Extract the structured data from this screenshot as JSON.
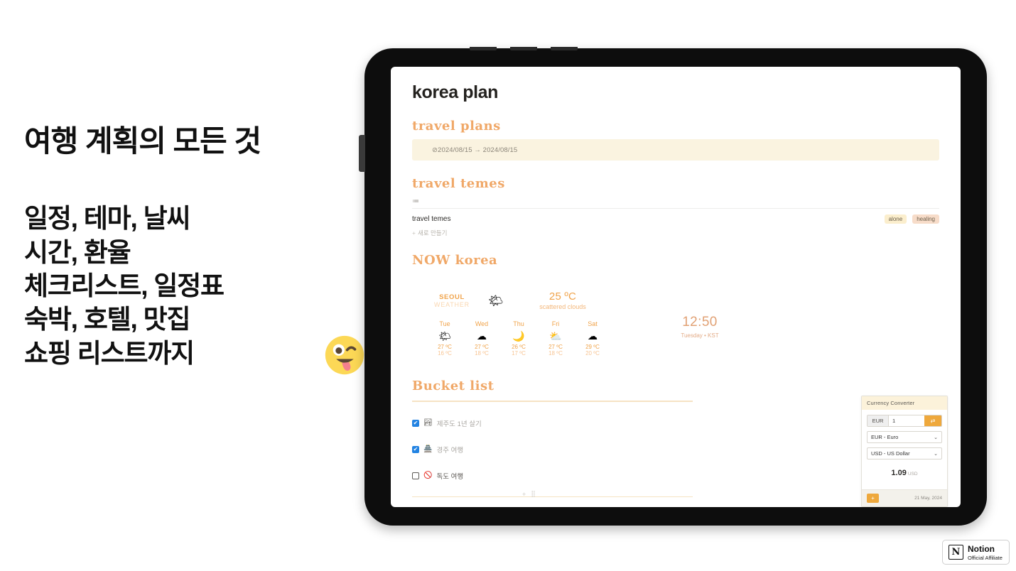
{
  "promo": {
    "headline": "여행 계획의 모든 것",
    "lines": [
      "일정, 테마, 날씨",
      "시간, 환율",
      "체크리스트, 일정표",
      "숙박, 호텔, 맛집",
      "쇼핑 리스트까지"
    ],
    "emoji": "😜"
  },
  "page": {
    "title": "korea plan",
    "travel_plans": {
      "heading": "travel plans",
      "date_range": "⊘2024/08/15 → 2024/08/15"
    },
    "travel_temes": {
      "heading": "travel temes",
      "db_icon": "≔",
      "row_name": "travel temes",
      "tags": [
        "alone",
        "healing"
      ],
      "new_label": "새로 만들기",
      "new_plus": "+"
    },
    "now_korea": {
      "heading": "NOW korea",
      "city": "SEOUL",
      "city_sub": "WEATHER",
      "current_icon": "🌤",
      "current_temp": "25 ºC",
      "current_desc": "scattered clouds",
      "forecast": [
        {
          "day": "Tue",
          "icon": "🌤",
          "high": "27 ºC",
          "low": "16 ºC"
        },
        {
          "day": "Wed",
          "icon": "☁",
          "high": "27 ºC",
          "low": "18 ºC"
        },
        {
          "day": "Thu",
          "icon": "🌙",
          "high": "26 ºC",
          "low": "17 ºC"
        },
        {
          "day": "Fri",
          "icon": "⛅",
          "high": "27 ºC",
          "low": "18 ºC"
        },
        {
          "day": "Sat",
          "icon": "☁",
          "high": "29 ºC",
          "low": "20 ºC"
        }
      ],
      "clock_time": "12:50",
      "clock_sub": "Tuesday • KST"
    },
    "bucket_list": {
      "heading": "Bucket list",
      "items": [
        {
          "checked": true,
          "emoji": "🏞",
          "label": "제주도 1년 살기",
          "check_glyph": "✔"
        },
        {
          "checked": true,
          "emoji": "🏯",
          "label": "경주 여행",
          "check_glyph": "✔"
        },
        {
          "checked": false,
          "emoji": "🚫",
          "label": "독도 여행",
          "check_glyph": ""
        }
      ],
      "handle_plus": "+",
      "handle_grip": "⣿"
    },
    "currency_converter": {
      "title": "Currency Converter",
      "input_prefix": "EUR",
      "input_value": "1",
      "swap_icon": "⇄",
      "from_currency": "EUR - Euro",
      "to_currency": "USD - US Dollar",
      "caret": "⌄",
      "result_amount": "1.09",
      "result_unit": "USD",
      "add_icon": "+",
      "date": "21 May, 2024"
    }
  },
  "badge": {
    "mark": "N",
    "line1": "Notion",
    "line2": "Official Affiliate"
  },
  "colors": {
    "accent_orange": "#f0a868",
    "banner_cream": "#faf3e0",
    "tag_alone": "#fbeecd",
    "tag_healing": "#f7dcc9",
    "checkbox_blue": "#2383e2",
    "cc_orange": "#eea83c"
  }
}
